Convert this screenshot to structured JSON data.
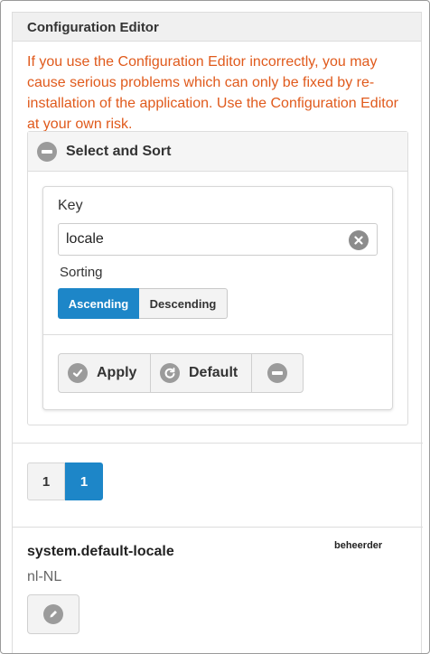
{
  "header": {
    "title": "Configuration Editor"
  },
  "warning": "If you use the Configuration Editor incorrectly, you may cause serious problems which can only be fixed by re-installation of the application. Use the Configuration Editor at your own risk.",
  "select_sort": {
    "title": "Select and Sort",
    "key_label": "Key",
    "key_value": "locale",
    "sorting_label": "Sorting",
    "sort_options": [
      "Ascending",
      "Descending"
    ],
    "sort_selected": "Ascending",
    "actions": {
      "apply": "Apply",
      "default": "Default"
    }
  },
  "pagination": {
    "pages": [
      "1",
      "1"
    ],
    "current_index": 1
  },
  "entries": [
    {
      "key": "system.default-locale",
      "role": "beheerder",
      "value": "nl-NL"
    }
  ],
  "colors": {
    "accent": "#1d86c8",
    "warning": "#e05a1c"
  },
  "icons": [
    "minus-circle-icon",
    "clear-icon",
    "check-circle-icon",
    "refresh-icon",
    "pencil-icon"
  ]
}
